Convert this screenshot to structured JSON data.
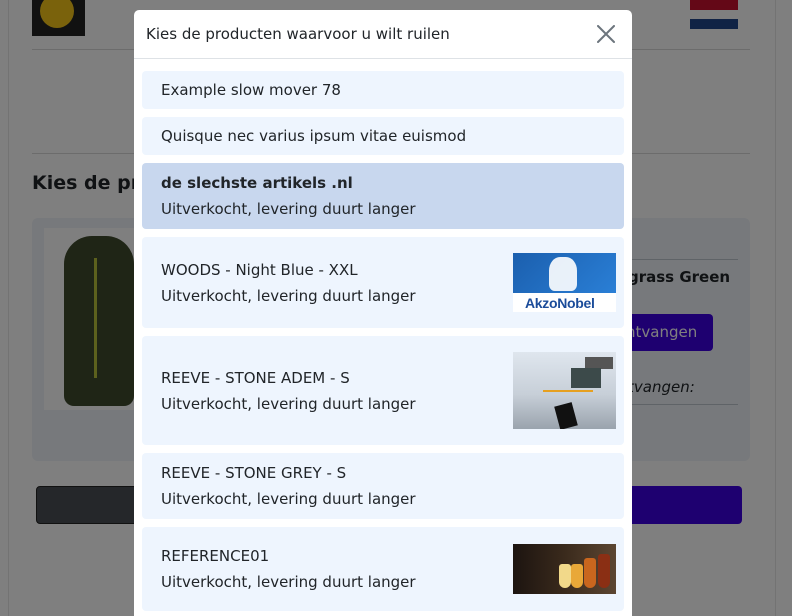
{
  "background": {
    "section_heading": "Kies de pro",
    "side_product_text": "grass Green",
    "side_button_label": "ntvangen",
    "side_label": "tvangen:"
  },
  "modal": {
    "title": "Kies de producten waarvoor u wilt ruilen",
    "close_icon": "close-icon",
    "items": [
      {
        "name": "Example slow mover 78",
        "status": "",
        "selected": false,
        "thumb": null
      },
      {
        "name": "Quisque nec varius ipsum vitae euismod",
        "status": "",
        "selected": false,
        "thumb": null
      },
      {
        "name": "de slechste artikels .nl",
        "status": "Uitverkocht, levering duurt langer",
        "selected": true,
        "thumb": null
      },
      {
        "name": "WOODS - Night Blue - XXL",
        "status": "Uitverkocht, levering duurt langer",
        "selected": false,
        "thumb": "akzonobel-logo-image"
      },
      {
        "name": "REEVE - STONE ADEM - S",
        "status": "Uitverkocht, levering duurt langer",
        "selected": false,
        "thumb": "desk-electronics-image"
      },
      {
        "name": "REEVE - STONE GREY - S",
        "status": "Uitverkocht, levering duurt langer",
        "selected": false,
        "thumb": null
      },
      {
        "name": "REFERENCE01",
        "status": "Uitverkocht, levering duurt langer",
        "selected": false,
        "thumb": "beer-glasses-image"
      }
    ],
    "thumb_texts": {
      "akzo_logo": "AkzoNobel"
    }
  },
  "colors": {
    "item_bg": "#eef5fe",
    "item_selected_bg": "#c8d7ee",
    "accent": "#3d00e0",
    "overlay": "rgba(0,0,0,0.5)"
  }
}
